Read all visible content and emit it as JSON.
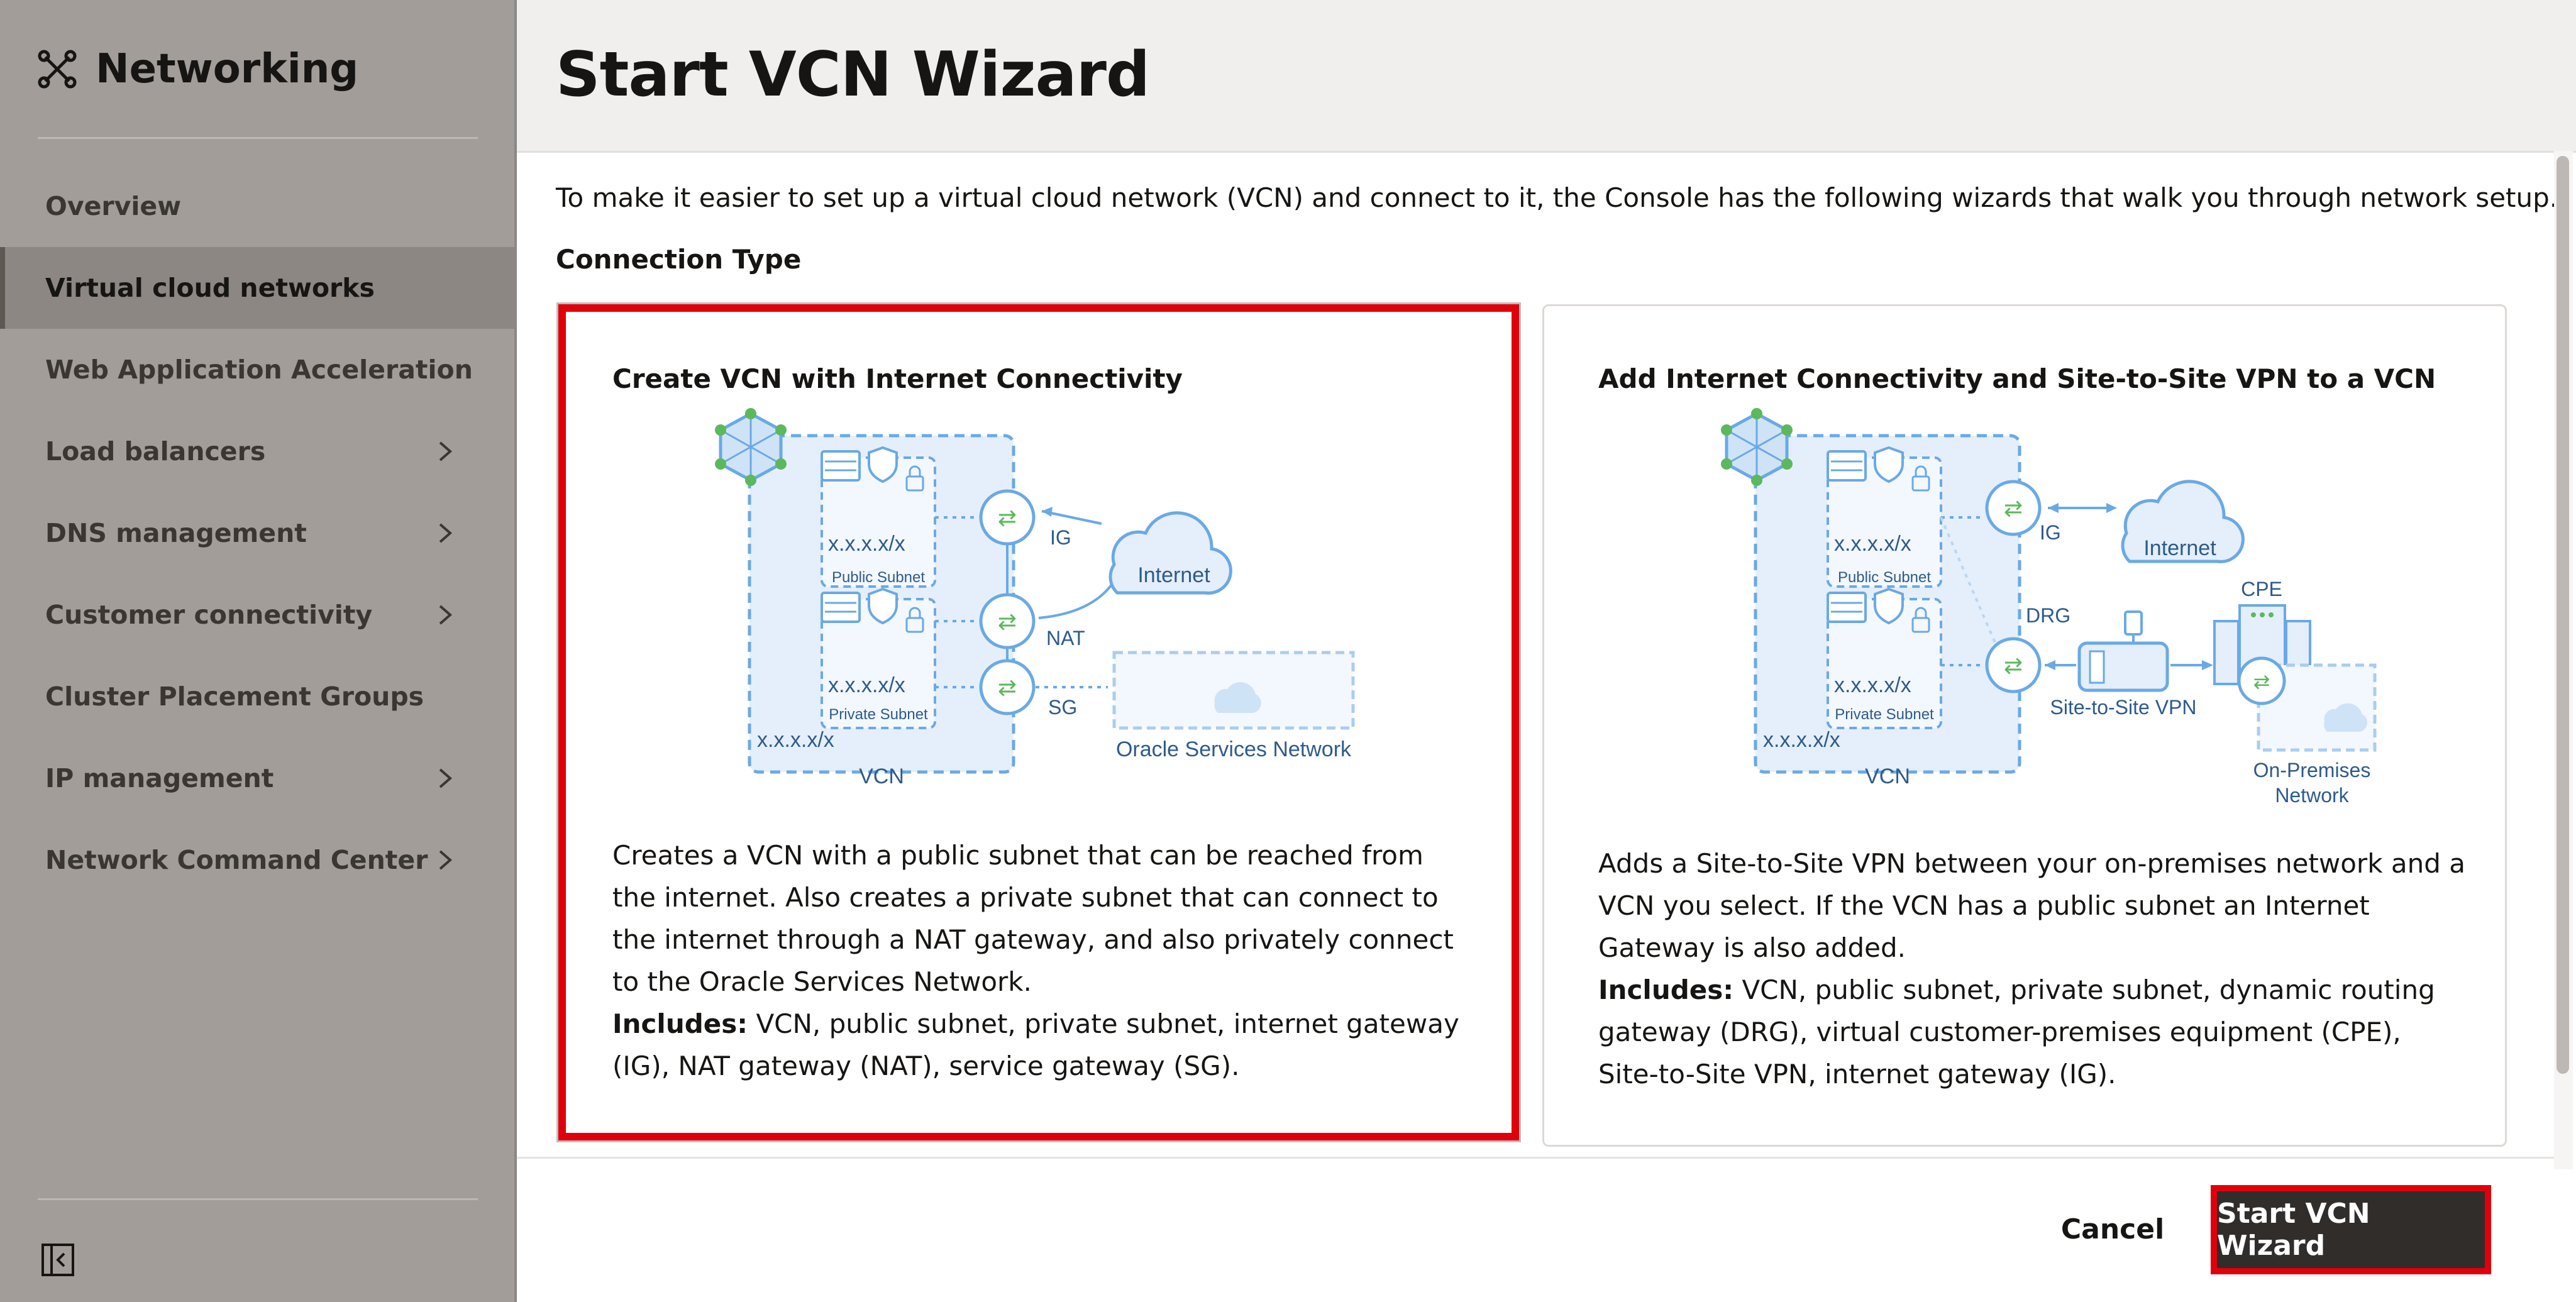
{
  "sidebar": {
    "title": "Networking",
    "logo_icon": "networking-icon",
    "items": [
      {
        "label": "Overview",
        "active": false,
        "has_submenu": false
      },
      {
        "label": "Virtual cloud networks",
        "active": true,
        "has_submenu": false
      },
      {
        "label": "Web Application Acceleration",
        "active": false,
        "has_submenu": false
      },
      {
        "label": "Load balancers",
        "active": false,
        "has_submenu": true
      },
      {
        "label": "DNS management",
        "active": false,
        "has_submenu": true
      },
      {
        "label": "Customer connectivity",
        "active": false,
        "has_submenu": true
      },
      {
        "label": "Cluster Placement Groups",
        "active": false,
        "has_submenu": false
      },
      {
        "label": "IP management",
        "active": false,
        "has_submenu": true
      },
      {
        "label": "Network Command Center",
        "active": false,
        "has_submenu": true
      }
    ],
    "collapse_icon": "collapse-sidebar-icon"
  },
  "main": {
    "title": "Start VCN Wizard",
    "intro": "To make it easier to set up a virtual cloud network (VCN) and connect to it, the Console has the following wizards that walk you through network setup.",
    "connection_type_label": "Connection Type",
    "cards": [
      {
        "title": "Create VCN with Internet Connectivity",
        "selected": true,
        "description": "Creates a VCN with a public subnet that can be reached from the internet. Also creates a private subnet that can connect to the internet through a NAT gateway, and also privately connect to the Oracle Services Network.",
        "includes_label": "Includes:",
        "includes_text": "VCN, public subnet, private subnet, internet gateway (IG), NAT gateway (NAT), service gateway (SG).",
        "diagram": {
          "public_cidr": "x.x.x.x/x",
          "public_subnet": "Public Subnet",
          "private_cidr": "x.x.x.x/x",
          "private_subnet": "Private Subnet",
          "vcn_cidr": "x.x.x.x/x",
          "vcn": "VCN",
          "ig": "IG",
          "nat": "NAT",
          "sg": "SG",
          "internet": "Internet",
          "osn": "Oracle Services Network"
        }
      },
      {
        "title": "Add Internet Connectivity and Site-to-Site VPN to a VCN",
        "selected": false,
        "description": "Adds a Site-to-Site VPN between your on-premises network and a VCN you select. If the VCN has a public subnet an Internet Gateway is also added.",
        "includes_label": "Includes:",
        "includes_text": "VCN, public subnet, private subnet, dynamic routing gateway (DRG), virtual customer-premises equipment (CPE), Site-to-Site VPN, internet gateway (IG).",
        "diagram": {
          "public_cidr": "x.x.x.x/x",
          "public_subnet": "Public Subnet",
          "private_cidr": "x.x.x.x/x",
          "private_subnet": "Private Subnet",
          "vcn_cidr": "x.x.x.x/x",
          "vcn": "VCN",
          "ig": "IG",
          "drg": "DRG",
          "internet": "Internet",
          "cpe": "CPE",
          "vpn": "Site-to-Site VPN",
          "onprem_1": "On-Premises",
          "onprem_2": "Network"
        }
      }
    ]
  },
  "footer": {
    "cancel_label": "Cancel",
    "primary_label": "Start VCN Wizard"
  },
  "colors": {
    "accent_red": "#e0000b",
    "primary_button": "#312d2a",
    "sidebar_bg": "#a29d98",
    "diagram_blue": "#6aa9e6",
    "diagram_green": "#5cb85c"
  }
}
